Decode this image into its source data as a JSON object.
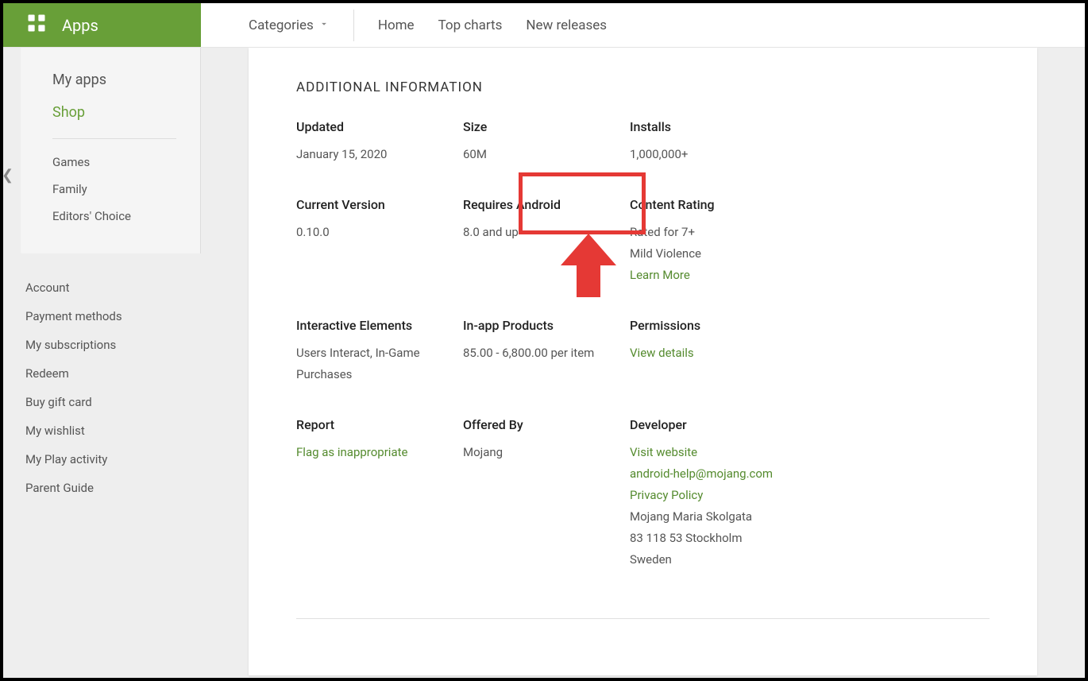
{
  "brand": {
    "label": "Apps"
  },
  "topnav": {
    "categories": "Categories",
    "home": "Home",
    "topcharts": "Top charts",
    "newreleases": "New releases"
  },
  "side1": {
    "myapps": "My apps",
    "shop": "Shop",
    "games": "Games",
    "family": "Family",
    "editors": "Editors' Choice"
  },
  "side2": {
    "account": "Account",
    "payment": "Payment methods",
    "subs": "My subscriptions",
    "redeem": "Redeem",
    "gift": "Buy gift card",
    "wishlist": "My wishlist",
    "activity": "My Play activity",
    "parent": "Parent Guide"
  },
  "section": "ADDITIONAL INFORMATION",
  "info": {
    "updated": {
      "label": "Updated",
      "value": "January 15, 2020"
    },
    "size": {
      "label": "Size",
      "value": "60M"
    },
    "installs": {
      "label": "Installs",
      "value": "1,000,000+"
    },
    "version": {
      "label": "Current Version",
      "value": "0.10.0"
    },
    "requires": {
      "label": "Requires Android",
      "value": "8.0 and up"
    },
    "rating": {
      "label": "Content Rating",
      "value1": "Rated for 7+",
      "value2": "Mild Violence",
      "link": "Learn More"
    },
    "interactive": {
      "label": "Interactive Elements",
      "value": "Users Interact, In-Game Purchases"
    },
    "inapp": {
      "label": "In-app Products",
      "value": " 85.00 -  6,800.00 per item"
    },
    "perm": {
      "label": "Permissions",
      "link": "View details"
    },
    "report": {
      "label": "Report",
      "link": "Flag as inappropriate"
    },
    "offered": {
      "label": "Offered By",
      "value": "Mojang"
    },
    "dev": {
      "label": "Developer",
      "website": "Visit website",
      "email": "android-help@mojang.com",
      "privacy": "Privacy Policy",
      "addr1": "Mojang Maria Skolgata",
      "addr2": "83 118 53 Stockholm",
      "addr3": "Sweden"
    }
  }
}
